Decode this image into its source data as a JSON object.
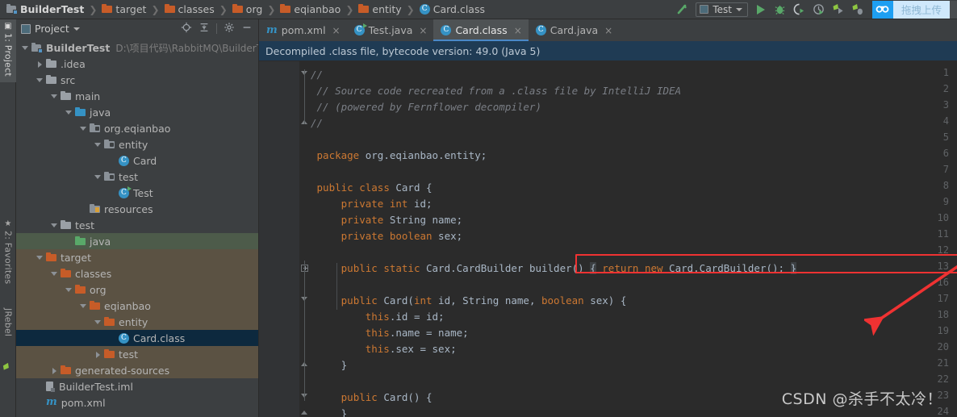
{
  "window": {
    "breadcrumb": [
      {
        "label": "BuilderTest",
        "icon": "module-icon"
      },
      {
        "label": "target",
        "icon": "folder-icon"
      },
      {
        "label": "classes",
        "icon": "folder-icon"
      },
      {
        "label": "org",
        "icon": "folder-icon"
      },
      {
        "label": "eqianbao",
        "icon": "folder-icon"
      },
      {
        "label": "entity",
        "icon": "folder-icon"
      },
      {
        "label": "Card.class",
        "icon": "class-icon"
      }
    ]
  },
  "toolbar": {
    "build_icon": "hammer-icon",
    "run_config": {
      "name": "Test",
      "icon": "run-config-icon",
      "caret": "chevron-down-icon"
    },
    "actions": [
      {
        "name": "run-button",
        "icon": "play-icon",
        "label": "Run"
      },
      {
        "name": "debug-button",
        "icon": "bug-icon",
        "label": "Debug"
      },
      {
        "name": "run-with-coverage-button",
        "icon": "coverage-icon",
        "label": "Run with Coverage"
      },
      {
        "name": "profile-button",
        "icon": "profiler-icon",
        "label": "Profile"
      },
      {
        "name": "jrebel-run-button",
        "icon": "jrebel-run-icon",
        "label": "Run with JRebel"
      },
      {
        "name": "jrebel-debug-button",
        "icon": "jrebel-debug-icon",
        "label": "Debug with JRebel"
      }
    ],
    "upload_badge": {
      "icon": "cloud-upload-icon",
      "label": "拖拽上传"
    }
  },
  "left_strip": {
    "tabs": [
      {
        "label": "1: Project",
        "icon": "project-icon",
        "active": true
      },
      {
        "label": "2: Favorites",
        "icon": "star-icon",
        "active": false
      },
      {
        "label": "JRebel",
        "icon": "jrebel-icon",
        "active": false
      }
    ]
  },
  "project_panel": {
    "title": "Project",
    "caret": "chevron-down-icon",
    "actions": [
      {
        "name": "locate-icon",
        "glyph": "⊕"
      },
      {
        "name": "collapse-all-icon",
        "glyph": "⇥"
      },
      {
        "name": "settings-gear-icon",
        "glyph": "✿"
      },
      {
        "name": "hide-panel-icon",
        "glyph": "—"
      }
    ],
    "tree": [
      {
        "indent": 0,
        "arrow": "open",
        "icon": "module-icon",
        "label": "BuilderTest",
        "bold": true,
        "path": "D:\\项目代码\\RabbitMQ\\BuilderTes",
        "bg": "none"
      },
      {
        "indent": 1,
        "arrow": "closed",
        "icon": "folder-gray",
        "label": ".idea",
        "bg": "none"
      },
      {
        "indent": 1,
        "arrow": "open",
        "icon": "folder-gray",
        "label": "src",
        "bg": "none"
      },
      {
        "indent": 2,
        "arrow": "open",
        "icon": "folder-gray",
        "label": "main",
        "bg": "none"
      },
      {
        "indent": 3,
        "arrow": "open",
        "icon": "folder-blue",
        "label": "java",
        "bg": "none"
      },
      {
        "indent": 4,
        "arrow": "open",
        "icon": "package-icon",
        "label": "org.eqianbao",
        "bg": "none"
      },
      {
        "indent": 5,
        "arrow": "open",
        "icon": "package-icon",
        "label": "entity",
        "bg": "none"
      },
      {
        "indent": 6,
        "arrow": "none",
        "icon": "class-icon",
        "label": "Card",
        "bg": "none"
      },
      {
        "indent": 5,
        "arrow": "open",
        "icon": "package-icon",
        "label": "test",
        "bg": "none"
      },
      {
        "indent": 6,
        "arrow": "none",
        "icon": "class-run-icon",
        "label": "Test",
        "bg": "none"
      },
      {
        "indent": 4,
        "arrow": "none",
        "icon": "resource-icon",
        "label": "resources",
        "bg": "none"
      },
      {
        "indent": 2,
        "arrow": "open",
        "icon": "folder-gray",
        "label": "test",
        "bg": "none"
      },
      {
        "indent": 3,
        "arrow": "none",
        "icon": "folder-green",
        "label": "java",
        "bg": "testsrc"
      },
      {
        "indent": 1,
        "arrow": "open",
        "icon": "folder-orange",
        "label": "target",
        "bg": "target"
      },
      {
        "indent": 2,
        "arrow": "open",
        "icon": "folder-orange",
        "label": "classes",
        "bg": "target"
      },
      {
        "indent": 3,
        "arrow": "open",
        "icon": "folder-orange",
        "label": "org",
        "bg": "target"
      },
      {
        "indent": 4,
        "arrow": "open",
        "icon": "folder-orange",
        "label": "eqianbao",
        "bg": "target"
      },
      {
        "indent": 5,
        "arrow": "open",
        "icon": "folder-orange",
        "label": "entity",
        "bg": "target"
      },
      {
        "indent": 6,
        "arrow": "none",
        "icon": "class-icon",
        "label": "Card.class",
        "bg": "selected"
      },
      {
        "indent": 5,
        "arrow": "closed",
        "icon": "folder-orange",
        "label": "test",
        "bg": "target"
      },
      {
        "indent": 2,
        "arrow": "closed",
        "icon": "folder-orange",
        "label": "generated-sources",
        "bg": "target"
      },
      {
        "indent": 1,
        "arrow": "none",
        "icon": "iml-icon",
        "label": "BuilderTest.iml",
        "bg": "none"
      },
      {
        "indent": 1,
        "arrow": "none",
        "icon": "maven-icon",
        "label": "pom.xml",
        "bg": "none"
      }
    ]
  },
  "editor": {
    "tabs": [
      {
        "label": "pom.xml",
        "icon": "maven-icon",
        "active": false,
        "close": "×"
      },
      {
        "label": "Test.java",
        "icon": "class-run-icon",
        "active": false,
        "close": "×"
      },
      {
        "label": "Card.class",
        "icon": "class-icon",
        "active": true,
        "close": "×"
      },
      {
        "label": "Card.java",
        "icon": "class-icon",
        "active": false,
        "close": "×"
      }
    ],
    "notification": "Decompiled .class file, bytecode version: 49.0 (Java 5)",
    "line_numbers": [
      "1",
      "2",
      "3",
      "4",
      "5",
      "6",
      "7",
      "8",
      "9",
      "10",
      "11",
      "12",
      "13",
      "16",
      "17",
      "18",
      "19",
      "20",
      "21",
      "22",
      "23",
      "24"
    ],
    "lines": [
      {
        "num": "1",
        "fold": "tri-down",
        "segments": [
          {
            "t": "//",
            "c": "cm"
          }
        ]
      },
      {
        "num": "2",
        "fold": "none",
        "segments": [
          {
            "t": " // Source code recreated from a .class file by IntelliJ IDEA",
            "c": "cm"
          }
        ]
      },
      {
        "num": "3",
        "fold": "none",
        "segments": [
          {
            "t": " // (powered by Fernflower decompiler)",
            "c": "cm"
          }
        ]
      },
      {
        "num": "4",
        "fold": "tri-up",
        "segments": [
          {
            "t": "//",
            "c": "cm"
          }
        ]
      },
      {
        "num": "5",
        "fold": "none",
        "segments": []
      },
      {
        "num": "6",
        "fold": "none",
        "segments": [
          {
            "t": " ",
            "c": "pl"
          },
          {
            "t": "package",
            "c": "kw"
          },
          {
            "t": " org.eqianbao.entity;",
            "c": "pl"
          }
        ]
      },
      {
        "num": "7",
        "fold": "none",
        "segments": []
      },
      {
        "num": "8",
        "fold": "none",
        "segments": [
          {
            "t": " ",
            "c": "pl"
          },
          {
            "t": "public class",
            "c": "kw"
          },
          {
            "t": " Card {",
            "c": "pl"
          }
        ]
      },
      {
        "num": "9",
        "fold": "none",
        "segments": [
          {
            "t": "     ",
            "c": "pl"
          },
          {
            "t": "private int",
            "c": "kw"
          },
          {
            "t": " id;",
            "c": "pl"
          }
        ]
      },
      {
        "num": "10",
        "fold": "none",
        "segments": [
          {
            "t": "     ",
            "c": "pl"
          },
          {
            "t": "private",
            "c": "kw"
          },
          {
            "t": " String name;",
            "c": "pl"
          }
        ]
      },
      {
        "num": "11",
        "fold": "none",
        "segments": [
          {
            "t": "     ",
            "c": "pl"
          },
          {
            "t": "private boolean",
            "c": "kw"
          },
          {
            "t": " sex;",
            "c": "pl"
          }
        ]
      },
      {
        "num": "12",
        "fold": "none",
        "segments": []
      },
      {
        "num": "13",
        "fold": "plus",
        "highlight": true,
        "segments": [
          {
            "t": "     ",
            "c": "pl"
          },
          {
            "t": "public static",
            "c": "kw"
          },
          {
            "t": " Card.CardBuilder builder() ",
            "c": "pl"
          },
          {
            "t": "{",
            "c": "folded"
          },
          {
            "t": " ",
            "c": "pl"
          },
          {
            "t": "return new",
            "c": "kw"
          },
          {
            "t": " Card.CardBuilder();",
            "c": "pl"
          },
          {
            "t": " ",
            "c": "pl"
          },
          {
            "t": "}",
            "c": "folded"
          }
        ]
      },
      {
        "num": "16",
        "fold": "none",
        "segments": []
      },
      {
        "num": "17",
        "fold": "tri-down",
        "segments": [
          {
            "t": "     ",
            "c": "pl"
          },
          {
            "t": "public",
            "c": "kw"
          },
          {
            "t": " Card(",
            "c": "pl"
          },
          {
            "t": "int",
            "c": "kw"
          },
          {
            "t": " id, String name, ",
            "c": "pl"
          },
          {
            "t": "boolean",
            "c": "kw"
          },
          {
            "t": " sex) {",
            "c": "pl"
          }
        ]
      },
      {
        "num": "18",
        "fold": "none",
        "segments": [
          {
            "t": "         ",
            "c": "pl"
          },
          {
            "t": "this",
            "c": "kw"
          },
          {
            "t": ".id = id;",
            "c": "pl"
          }
        ]
      },
      {
        "num": "19",
        "fold": "none",
        "segments": [
          {
            "t": "         ",
            "c": "pl"
          },
          {
            "t": "this",
            "c": "kw"
          },
          {
            "t": ".name = name;",
            "c": "pl"
          }
        ]
      },
      {
        "num": "20",
        "fold": "none",
        "segments": [
          {
            "t": "         ",
            "c": "pl"
          },
          {
            "t": "this",
            "c": "kw"
          },
          {
            "t": ".sex = sex;",
            "c": "pl"
          }
        ]
      },
      {
        "num": "21",
        "fold": "tri-up",
        "segments": [
          {
            "t": "     }",
            "c": "pl"
          }
        ]
      },
      {
        "num": "22",
        "fold": "none",
        "segments": []
      },
      {
        "num": "23",
        "fold": "tri-down",
        "segments": [
          {
            "t": "     ",
            "c": "pl"
          },
          {
            "t": "public",
            "c": "kw"
          },
          {
            "t": " Card() {",
            "c": "pl"
          }
        ]
      },
      {
        "num": "24",
        "fold": "tri-up",
        "segments": [
          {
            "t": "     }",
            "c": "pl"
          }
        ]
      }
    ]
  },
  "annotations": {
    "arrow_color": "#ef3232",
    "highlight_box_color": "#ef3232",
    "watermark": "CSDN @杀手不太冷！"
  }
}
